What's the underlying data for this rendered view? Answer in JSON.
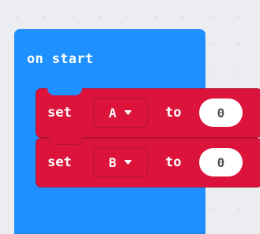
{
  "colors": {
    "hat": "#1e90ff",
    "set": "#dc143c",
    "set_dark": "#b41234"
  },
  "on_start": {
    "label": "on start"
  },
  "blocks": [
    {
      "set_label": "set",
      "variable": "A",
      "dropdown_icon": "caret-down-icon",
      "to_label": "to",
      "value": "0"
    },
    {
      "set_label": "set",
      "variable": "B",
      "dropdown_icon": "caret-down-icon",
      "to_label": "to",
      "value": "0"
    }
  ]
}
